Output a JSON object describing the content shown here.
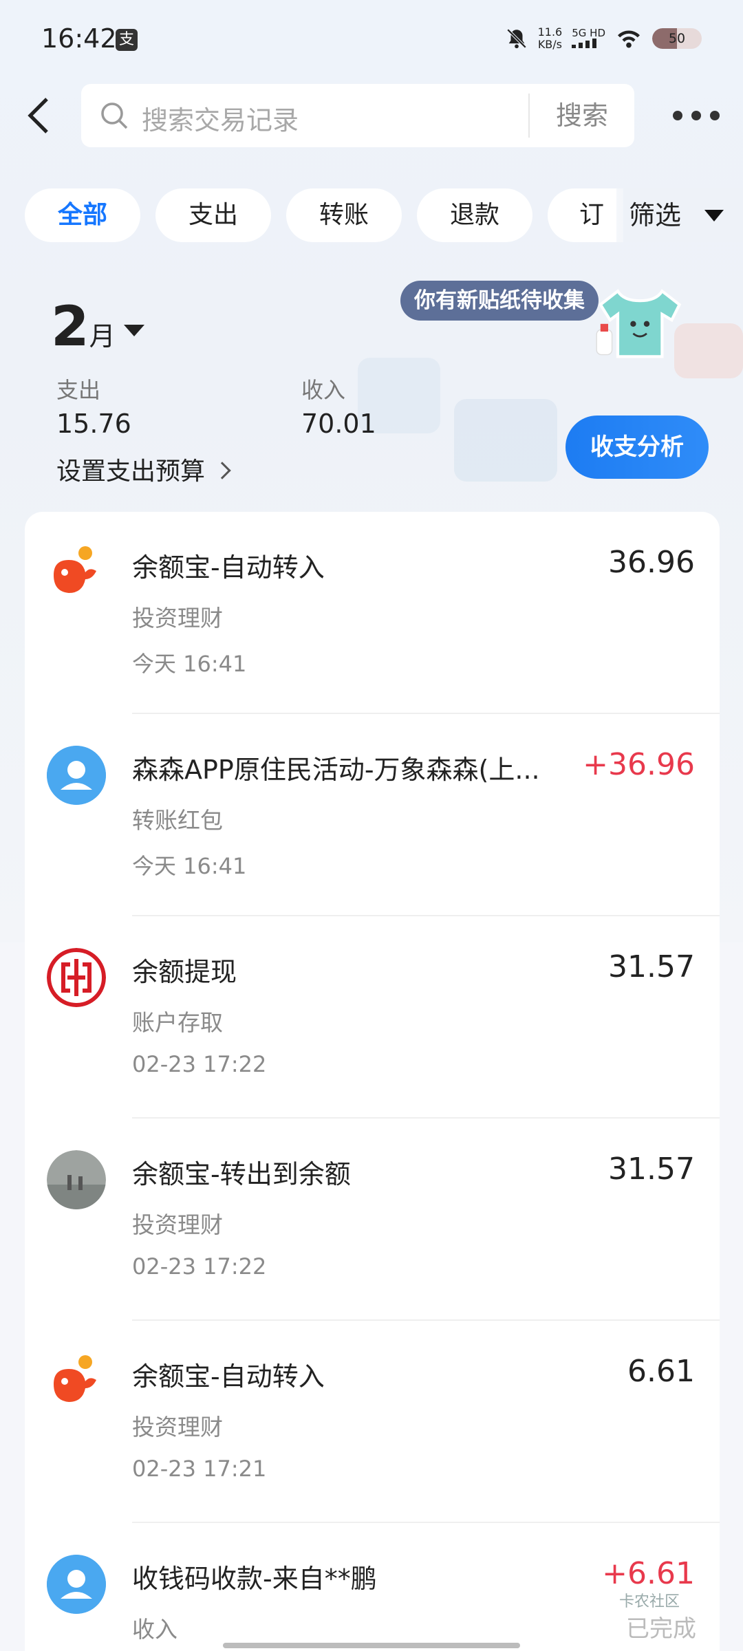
{
  "status": {
    "time": "16:42",
    "app_icon": "支",
    "net_speed_value": "11.6",
    "net_speed_unit": "KB/s",
    "signal_label": "5G HD",
    "battery": "50"
  },
  "header": {
    "search_placeholder": "搜索交易记录",
    "search_button": "搜索"
  },
  "tabs": [
    {
      "label": "全部"
    },
    {
      "label": "支出"
    },
    {
      "label": "转账"
    },
    {
      "label": "退款"
    },
    {
      "label": "订单"
    }
  ],
  "filter_label": "筛选",
  "summary": {
    "month_num": "2",
    "month_unit": "月",
    "expense_label": "支出",
    "expense_value": "15.76",
    "income_label": "收入",
    "income_value": "70.01",
    "budget_label": "设置支出预算",
    "sticker_tip": "你有新贴纸待收集",
    "analysis_button": "收支分析"
  },
  "transactions": [
    {
      "title": "余额宝-自动转入",
      "category": "投资理财",
      "time": "今天 16:41",
      "amount": "36.96",
      "icon": "yuebao-icon"
    },
    {
      "title": "森森APP原住民活动-万象森森(上...",
      "category": "转账红包",
      "time": "今天 16:41",
      "amount": "+36.96",
      "icon": "user-avatar-icon"
    },
    {
      "title": "余额提现",
      "category": "账户存取",
      "time": "02-23 17:22",
      "amount": "31.57",
      "icon": "icbc-bank-icon"
    },
    {
      "title": "余额宝-转出到余额",
      "category": "投资理财",
      "time": "02-23 17:22",
      "amount": "31.57",
      "icon": "photo-avatar-icon"
    },
    {
      "title": "余额宝-自动转入",
      "category": "投资理财",
      "time": "02-23 17:21",
      "amount": "6.61",
      "icon": "yuebao-icon"
    },
    {
      "title": "收钱码收款-来自**鹏",
      "category": "收入",
      "time": "",
      "amount": "+6.61",
      "icon": "user-avatar-icon"
    }
  ],
  "watermark": {
    "line1": "卡农社区",
    "line2": "已完成"
  },
  "colors": {
    "accent": "#1677ff",
    "income": "#e8394c"
  }
}
